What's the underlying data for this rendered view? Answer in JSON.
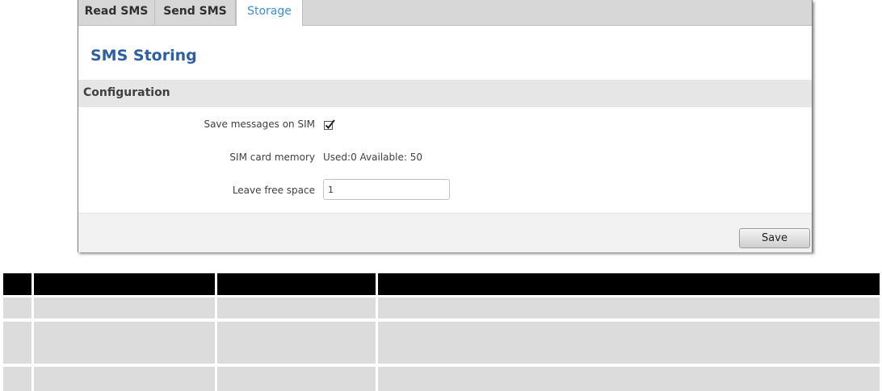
{
  "tabs": [
    {
      "label": "Read SMS",
      "active": false
    },
    {
      "label": "Send SMS",
      "active": false
    },
    {
      "label": "Storage",
      "active": true
    }
  ],
  "page_title": "SMS Storing",
  "section_title": "Configuration",
  "fields": {
    "save_on_sim": {
      "label": "Save messages on SIM",
      "checked": true
    },
    "sim_memory": {
      "label": "SIM card memory",
      "value": "Used:0 Available: 50"
    },
    "free_space": {
      "label": "Leave free space",
      "value": "1"
    }
  },
  "save_label": "Save",
  "colors": {
    "accent": "#3b8fd0",
    "title": "#2f5f9e",
    "table_header": "#000000",
    "table_row": "#dcdcdc"
  }
}
